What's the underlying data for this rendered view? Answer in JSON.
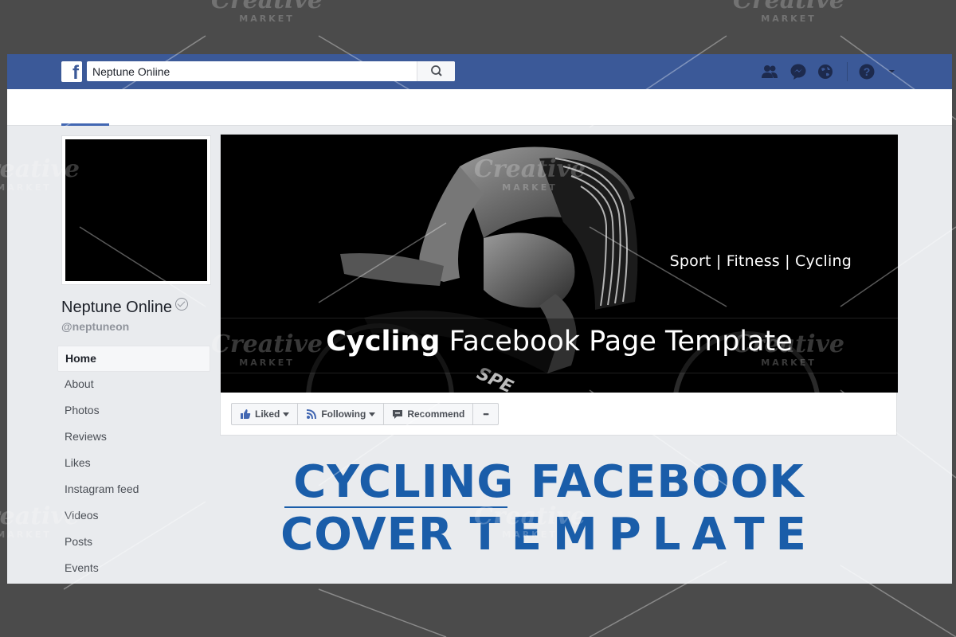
{
  "watermark": {
    "brand": "Creative",
    "sub": "MARKET"
  },
  "header": {
    "logo": "f",
    "search": {
      "value": "Neptune Online",
      "placeholder": "Search"
    },
    "icons": [
      "friend-requests-icon",
      "messenger-icon",
      "notifications-globe-icon",
      "help-icon",
      "account-menu-chevron-icon"
    ]
  },
  "page": {
    "name": "Neptune Online",
    "handle": "@neptuneon"
  },
  "sidebar": {
    "items": [
      {
        "label": "Home",
        "active": true
      },
      {
        "label": "About"
      },
      {
        "label": "Photos"
      },
      {
        "label": "Reviews"
      },
      {
        "label": "Likes"
      },
      {
        "label": "Instagram feed"
      },
      {
        "label": "Videos"
      },
      {
        "label": "Posts"
      },
      {
        "label": "Events"
      }
    ]
  },
  "cover": {
    "tagline": "Sport | Fitness | Cycling",
    "title_bold": "Cycling",
    "title_rest": "Facebook Page Template"
  },
  "actions": {
    "liked": "Liked",
    "following": "Following",
    "recommend": "Recommend",
    "more": "•••"
  },
  "promo": {
    "line1": "CYCLING FACEBOOK",
    "line2_a": "COVER",
    "line2_b": "TEMPLATE"
  },
  "colors": {
    "facebook_blue": "#3b5998",
    "promo_blue": "#1a5da9",
    "page_bg": "#e9ebee",
    "frame_bg": "#4b4b4b"
  }
}
